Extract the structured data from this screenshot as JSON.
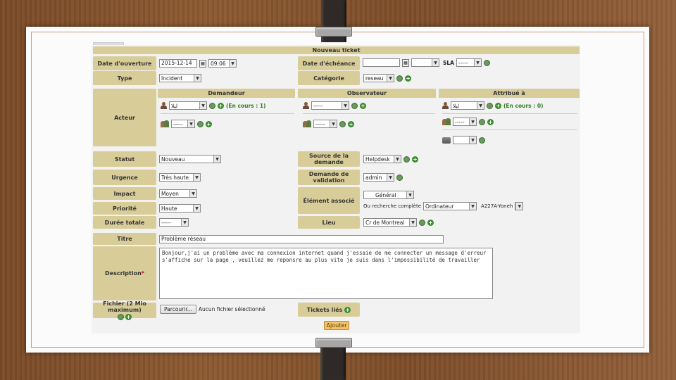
{
  "title": "Nouveau ticket",
  "opening": {
    "label": "Date d'ouverture",
    "date": "2015-12-14",
    "time": "09:06"
  },
  "due": {
    "label": "Date d'échéance",
    "sla_label": "SLA",
    "sla_value": "-----"
  },
  "type": {
    "label": "Type",
    "value": "Incident"
  },
  "category": {
    "label": "Catégorie",
    "value": "reseau"
  },
  "actor": {
    "label": "Acteur",
    "requester": {
      "header": "Demandeur",
      "user": "ليلا",
      "count": "(En cours : 1)",
      "group": "-----"
    },
    "observer": {
      "header": "Observateur",
      "user": "-----",
      "group": "-----"
    },
    "assigned": {
      "header": "Attribué à",
      "user": "ليلا",
      "count": "(En cours : 0)",
      "group": "-----",
      "supplier": ""
    }
  },
  "status": {
    "label": "Statut",
    "value": "Nouveau"
  },
  "source": {
    "label": "Source de la demande",
    "value": "Helpdesk"
  },
  "urgency": {
    "label": "Urgence",
    "value": "Très haute"
  },
  "validation": {
    "label": "Demande de validation",
    "value": "admin"
  },
  "impact": {
    "label": "Impact",
    "value": "Moyen"
  },
  "element": {
    "label": "Élément associé",
    "general": "Général",
    "search_text": "Ou recherche complète",
    "type_value": "Ordinateur",
    "item_value": "A227A-Yoneh"
  },
  "priority": {
    "label": "Priorité",
    "value": "Haute"
  },
  "duration": {
    "label": "Durée totale",
    "value": "-----"
  },
  "location": {
    "label": "Lieu",
    "value": "Cr de Montreal"
  },
  "ticket_title": {
    "label": "Titre",
    "value": "Problème réseau"
  },
  "description": {
    "label": "Description",
    "required_mark": "*",
    "value": "Bonjour,j'ai un problème avec ma connexion internet quand j'essaie de me connecter un message d'erreur s'affiche sur la page , veuillez me reponsre au plus vite je suis dans l'impossibilité de travailler"
  },
  "file": {
    "label": "Fichier (2 Mio maximum)",
    "browse": "Parcourir...",
    "none": "Aucun fichier sélectionné"
  },
  "linked": {
    "label": "Tickets liés"
  },
  "submit_label": "Ajouter"
}
